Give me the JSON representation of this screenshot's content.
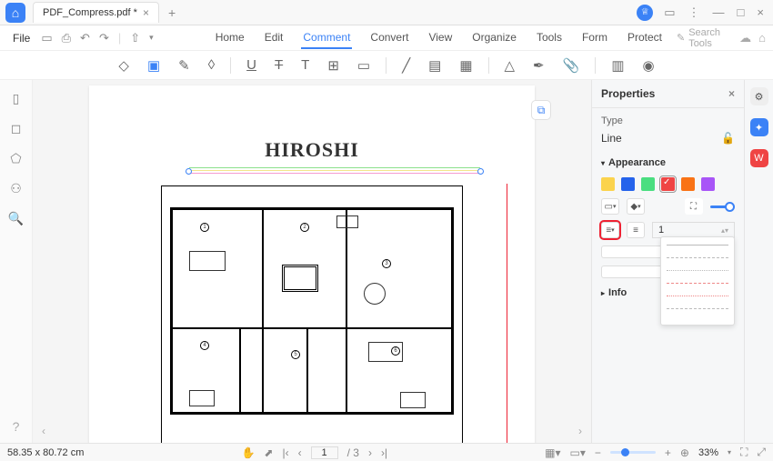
{
  "titlebar": {
    "filename": "PDF_Compress.pdf *"
  },
  "menubar": {
    "file": "File",
    "items": [
      "Home",
      "Edit",
      "Comment",
      "Convert",
      "View",
      "Organize",
      "Tools",
      "Form",
      "Protect"
    ],
    "active_index": 2,
    "search_placeholder": "Search Tools"
  },
  "document": {
    "title": "HIROSHI"
  },
  "properties": {
    "header": "Properties",
    "type_label": "Type",
    "type_value": "Line",
    "appearance_label": "Appearance",
    "thickness": "1",
    "info_label": "Info",
    "colors": [
      "#fbd34d",
      "#2563eb",
      "#4ade80",
      "#ef4444",
      "#f97316",
      "#a855f7"
    ],
    "selected_color_index": 3
  },
  "status": {
    "dims": "58.35 x 80.72 cm",
    "page_current": "1",
    "page_total": "3",
    "zoom": "33%"
  }
}
